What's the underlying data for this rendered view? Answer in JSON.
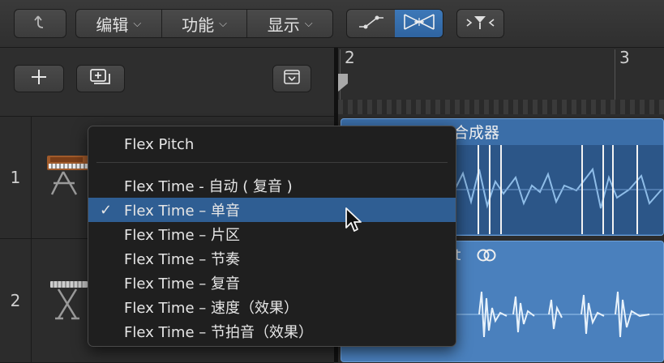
{
  "toolbar": {
    "menus": [
      {
        "label": "编辑"
      },
      {
        "label": "功能"
      },
      {
        "label": "显示"
      }
    ]
  },
  "ruler": {
    "bar_2": "2",
    "bar_3": "3"
  },
  "tracks": [
    {
      "number": "1",
      "region_title": "合成器"
    },
    {
      "number": "2",
      "region_title": "t"
    }
  ],
  "flex_menu": {
    "items": [
      {
        "label": "Flex Pitch",
        "selected": false
      },
      {
        "label": "Flex Time - 自动 ( 复音 )",
        "selected": false
      },
      {
        "label": "Flex Time – 单音",
        "selected": true
      },
      {
        "label": "Flex Time – 片区",
        "selected": false
      },
      {
        "label": "Flex Time – 节奏",
        "selected": false
      },
      {
        "label": "Flex Time – 复音",
        "selected": false
      },
      {
        "label": "Flex Time – 速度（效果）",
        "selected": false
      },
      {
        "label": "Flex Time – 节拍音（效果）",
        "selected": false
      }
    ],
    "check_mark": "✓"
  },
  "colors": {
    "accent": "#2f5e93",
    "region": "#3b6ea8"
  }
}
